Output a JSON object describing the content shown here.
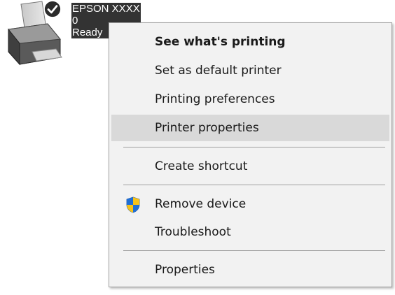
{
  "printer": {
    "name": "EPSON XXXX",
    "jobs": "0",
    "status": "Ready",
    "icon": "printer-icon",
    "default_badge_icon": "checkmark-circle-icon"
  },
  "menu": {
    "items": [
      {
        "label": "See what's printing",
        "bold": true
      },
      {
        "label": "Set as default printer"
      },
      {
        "label": "Printing preferences"
      },
      {
        "label": "Printer properties",
        "highlighted": true
      },
      {
        "label": "Create shortcut"
      },
      {
        "label": "Remove device",
        "icon": "uac-shield-icon"
      },
      {
        "label": "Troubleshoot"
      },
      {
        "label": "Properties"
      }
    ]
  },
  "colors": {
    "menu_background": "#f2f2f2",
    "hover_background": "#d9d9d9",
    "label_selection": "#333333"
  }
}
